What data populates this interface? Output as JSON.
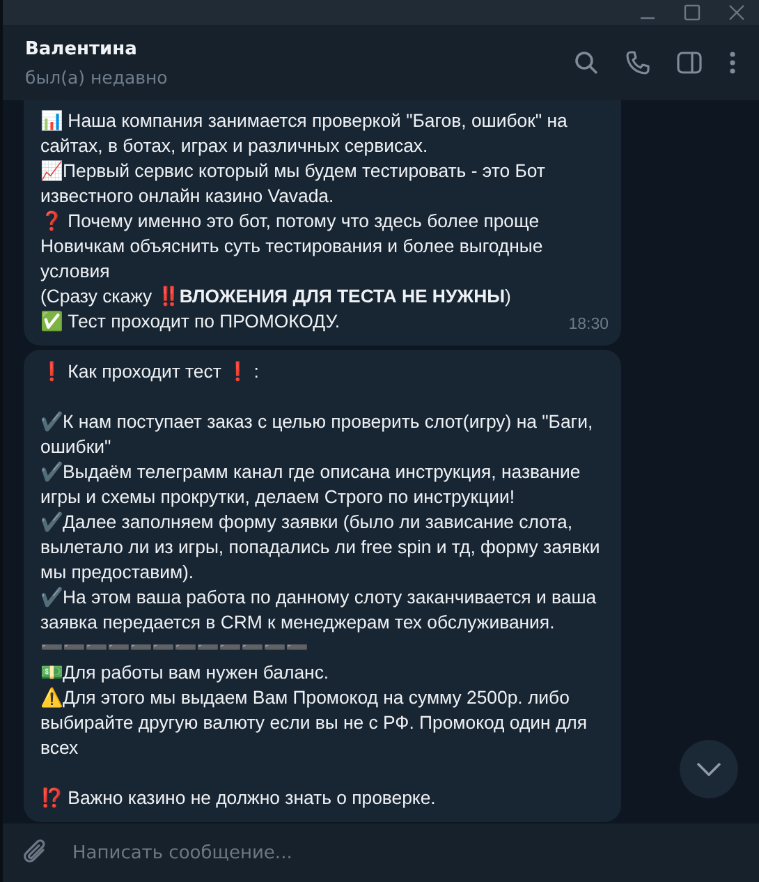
{
  "chat": {
    "name": "Валентина",
    "status": "был(а) недавно"
  },
  "messages": [
    {
      "blocks": [
        [
          "📊 Наша компания занимается проверкой \"Багов, ошибок\" на сайтах,  в ботах, играх и различных сервисах.",
          "📈Первый сервис который мы будем тестировать - это Бот известного онлайн казино Vavada.",
          " ❓ Почему именно это бот, потому что здесь более проще Новичкам объяснить суть тестирования и более выгодные условия",
          "(Сразу скажу ‼️**ВЛОЖЕНИЯ ДЛЯ ТЕСТА НЕ НУЖНЫ**)",
          "✅ Тест проходит по ПРОМОКОДУ."
        ]
      ],
      "time": "18:30"
    },
    {
      "blocks": [
        [
          " ❗ Как проходит тест ❗ :"
        ],
        [
          "✔️К нам поступает заказ с целью проверить слот(игру) на \"Баги, ошибки\"",
          "✔️Выдаём телеграмм канал где описана инструкция, название игры и схемы прокрутки, делаем Строго по инструкции!",
          "✔️Далее заполняем форму заявки (было ли зависание слота, вылетало ли из игры,  попадались ли free spin и тд, форму заявки мы предоставим).",
          "✔️На этом ваша работа по данному слоту заканчивается и ваша заявка передается в CRM к менеджерам тех обслуживания.",
          "➖➖➖➖➖➖➖➖➖➖➖➖",
          "💵Для работы вам нужен баланс.",
          "⚠️Для этого мы выдаем Вам Промокод на сумму 2500р. либо выбирайте другую валюту если вы не с РФ. Промокод один для всех"
        ],
        [
          "⁉️ Важно казино не должно знать о проверке."
        ]
      ]
    }
  ],
  "composer": {
    "placeholder": "Написать сообщение..."
  }
}
